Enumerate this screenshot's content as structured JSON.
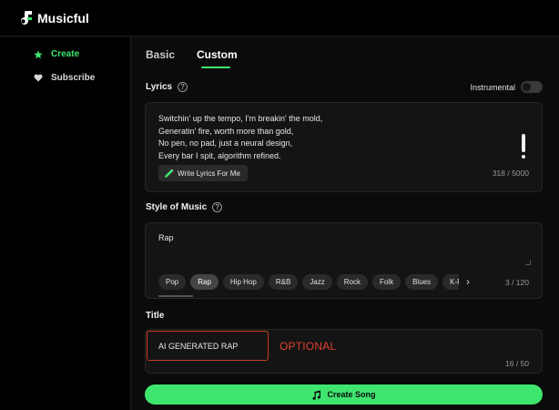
{
  "app": {
    "name": "Musicful"
  },
  "sidebar": {
    "items": [
      {
        "label": "Create",
        "icon": "star-icon",
        "active": true
      },
      {
        "label": "Subscribe",
        "icon": "heart-icon",
        "active": false
      }
    ]
  },
  "tabs": [
    {
      "label": "Basic",
      "active": false
    },
    {
      "label": "Custom",
      "active": true
    }
  ],
  "lyrics": {
    "label": "Lyrics",
    "instrumental_label": "Instrumental",
    "instrumental_on": false,
    "text": "Switchin' up the tempo, I'm breakin' the mold,\nGeneratin' fire, worth more than gold,\nNo pen, no pad, just a neural design,\nEvery bar I spit, algorithm refined.",
    "write_button_label": "Write Lyrics For Me",
    "counter": "318 / 5000"
  },
  "style": {
    "label": "Style of Music",
    "value": "Rap",
    "chips": [
      "Pop",
      "Rap",
      "Hip Hop",
      "R&B",
      "Jazz",
      "Rock",
      "Folk",
      "Blues",
      "K-Pop"
    ],
    "selected_chip": "Rap",
    "counter": "3 / 120"
  },
  "title": {
    "label": "Title",
    "value": "AI GENERATED RAP",
    "note": "OPTIONAL",
    "counter": "16 / 50"
  },
  "create_button": {
    "label": "Create Song"
  },
  "colors": {
    "accent": "#3ee66e",
    "highlight_red": "#e0402e",
    "background": "#0b0b0b"
  }
}
